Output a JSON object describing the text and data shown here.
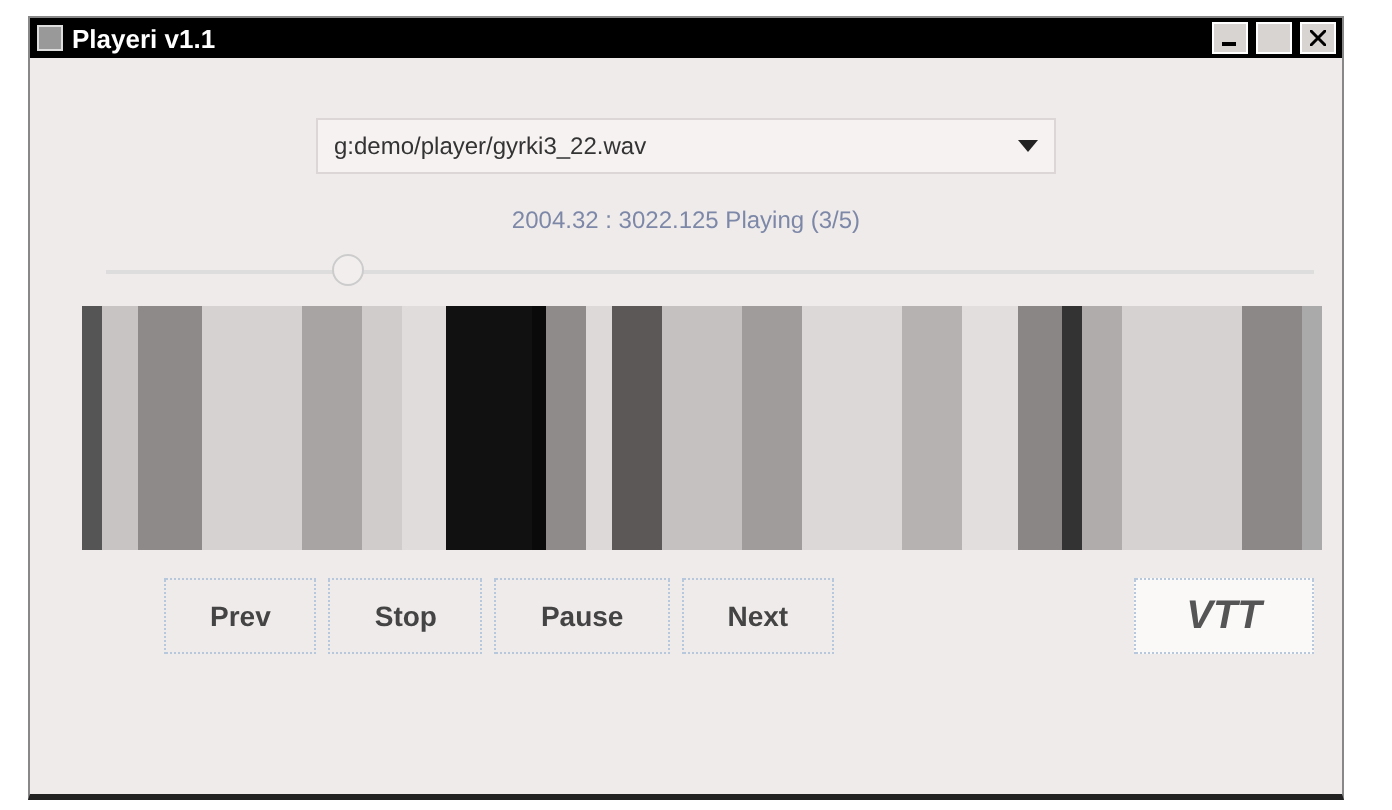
{
  "window": {
    "title": "Playeri v1.1"
  },
  "file_select": {
    "value": "g:demo/player/gyrki3_22.wav"
  },
  "status": "2004.32 : 3022.125 Playing (3/5)",
  "position_slider": {
    "level": 0.2
  },
  "buttons": [
    "Prev",
    "Stop",
    "Pause",
    "Next"
  ],
  "logo_button": {
    "label": "VTT"
  }
}
